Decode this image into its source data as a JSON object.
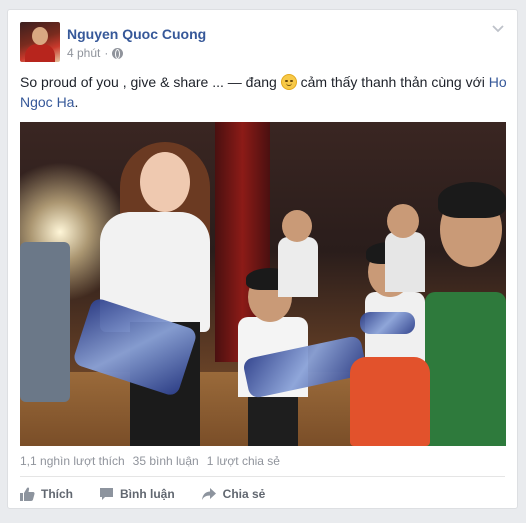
{
  "post": {
    "author": "Nguyen Quoc Cuong",
    "time": "4 phút",
    "time_separator": "·",
    "text_before": "So proud of you , give & share ... — đang ",
    "text_feeling": " cảm thấy thanh thản cùng với ",
    "tagged": "Ho Ngoc Ha",
    "text_end": "."
  },
  "stats": {
    "likes": "1,1 nghìn lượt thích",
    "comments": "35 bình luận",
    "shares": "1 lượt chia sẻ"
  },
  "actions": {
    "like": "Thích",
    "comment": "Bình luận",
    "share": "Chia sẻ"
  },
  "icons": {
    "menu": "chevron-down-icon",
    "privacy": "globe-icon",
    "feeling": "relieved-face-icon",
    "like": "thumbs-up-icon",
    "comment": "speech-bubble-icon",
    "share": "share-arrow-icon"
  },
  "colors": {
    "link": "#365899",
    "text": "#1d2129",
    "muted": "#90949c",
    "action": "#616770"
  }
}
